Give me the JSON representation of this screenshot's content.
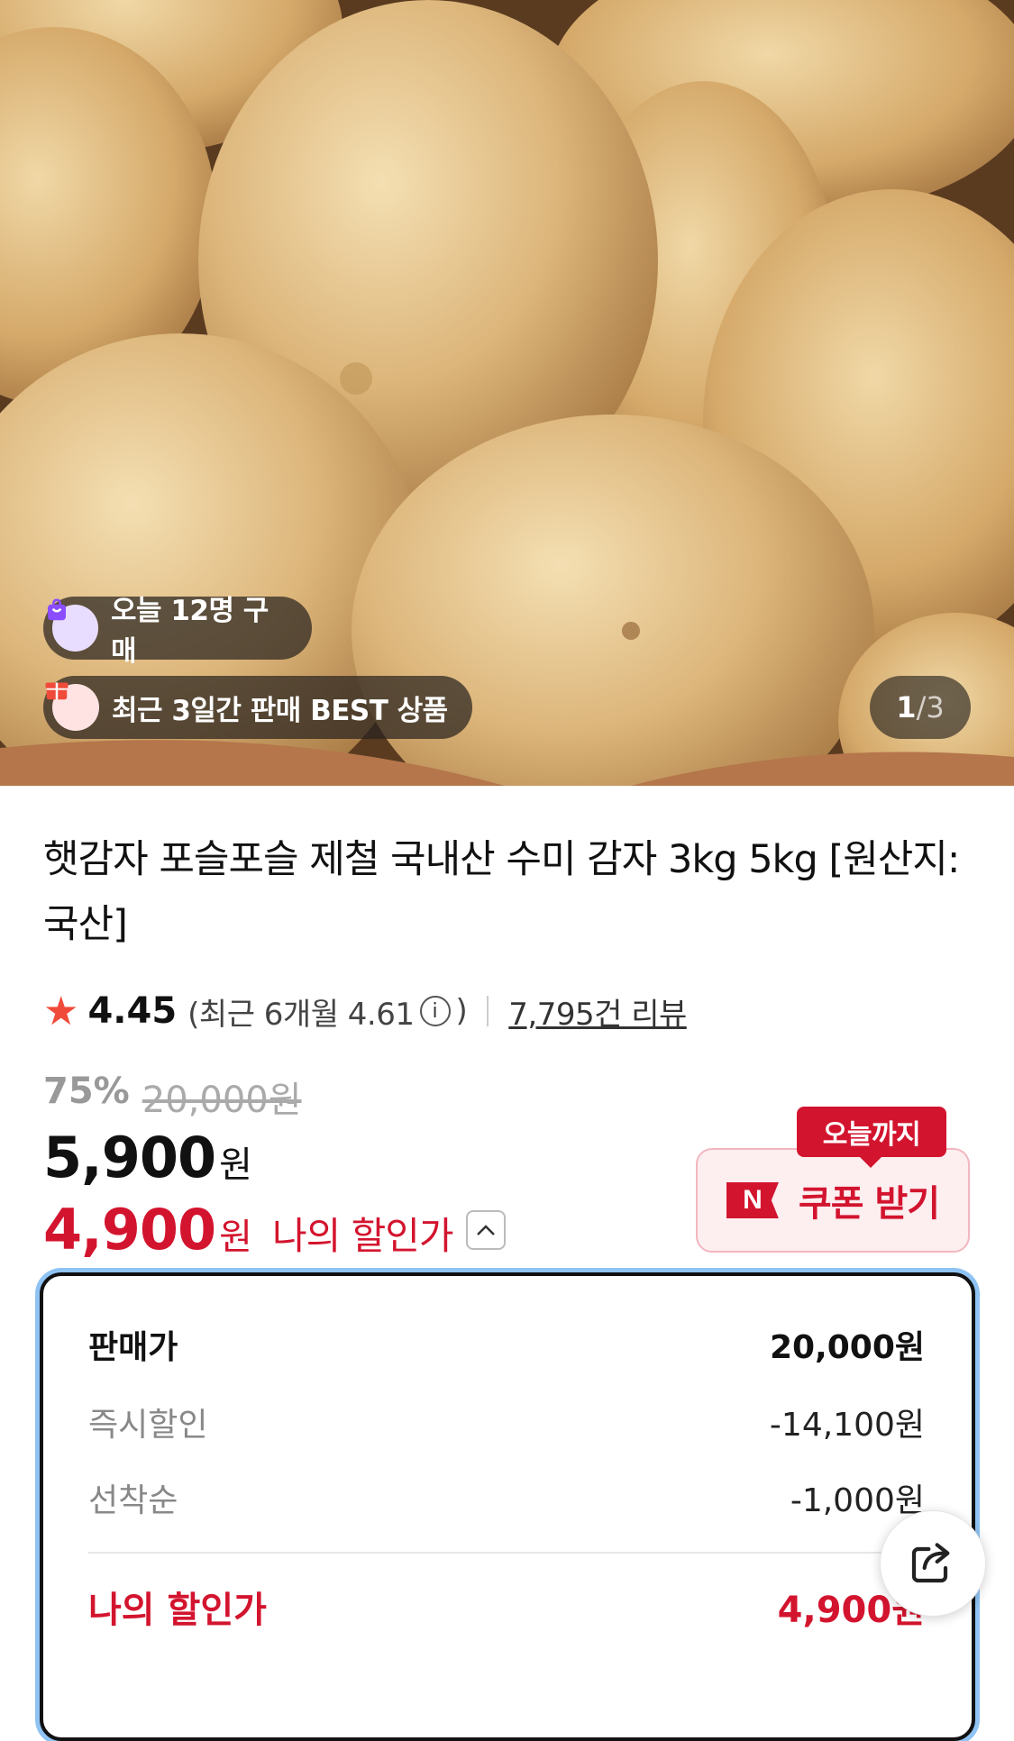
{
  "hero": {
    "badge_today": "오늘 12명 구매",
    "badge_best": "최근 3일간 판매 BEST 상품",
    "counter_current": "1",
    "counter_sep": "/",
    "counter_total": "3"
  },
  "product": {
    "title": "햇감자 포슬포슬 제철 국내산 수미 감자 3kg 5kg [원산지:국산]",
    "rating": "4.45",
    "recent_rating_open": "(최근 6개월 4.61",
    "recent_rating_close": ")",
    "review_count": "7,795건 리뷰"
  },
  "pricing": {
    "discount_rate": "75%",
    "original_price": "20,000원",
    "price": "5,900",
    "price_unit": "원",
    "my_price": "4,900",
    "my_price_unit": "원",
    "my_price_label": "나의 할인가"
  },
  "coupon": {
    "tag": "오늘까지",
    "icon_letter": "N",
    "label": "쿠폰 받기"
  },
  "breakdown": {
    "sale_label": "판매가",
    "sale_value": "20,000원",
    "instant_label": "즉시할인",
    "instant_value": "-14,100원",
    "first_label": "선착순",
    "first_value": "-1,000원",
    "my_label": "나의 할인가",
    "my_value": "4,900원"
  },
  "colors": {
    "accent_red": "#d3142e",
    "star": "#f04b3a",
    "focus_ring": "#8fc3f3"
  },
  "icons": {
    "bag": "shopping-bag-icon",
    "gift": "gift-icon",
    "star": "star-icon",
    "info": "info-icon",
    "chevron": "chevron-up-icon",
    "share": "share-icon"
  }
}
